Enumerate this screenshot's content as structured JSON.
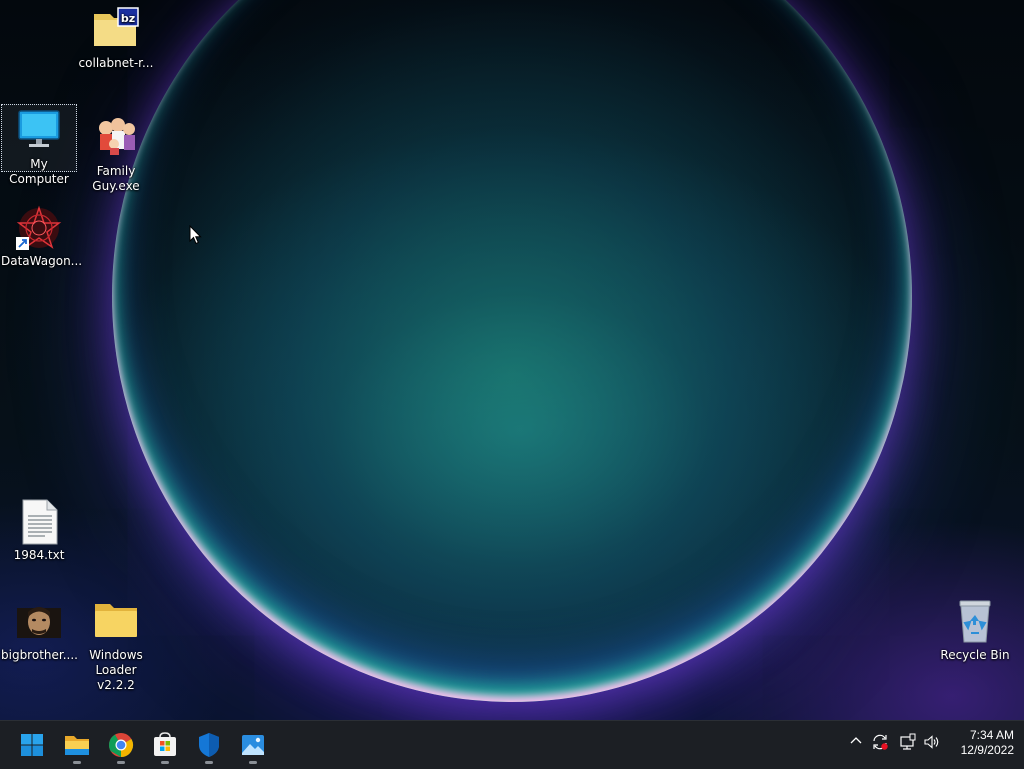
{
  "desktop": {
    "icons": [
      {
        "label": "collabnet-r...",
        "icon": "zip-folder-icon"
      },
      {
        "label": "My Computer",
        "icon": "monitor-icon",
        "selected": true
      },
      {
        "label": "Family Guy.exe",
        "icon": "family-guy-icon"
      },
      {
        "label": "DataWagon...",
        "icon": "datawagon-shortcut-icon"
      },
      {
        "label": "1984.txt",
        "icon": "text-file-icon"
      },
      {
        "label": "bigbrother....",
        "icon": "image-file-icon"
      },
      {
        "label": "Windows Loader v2.2.2",
        "icon": "folder-icon"
      },
      {
        "label": "Recycle Bin",
        "icon": "recycle-bin-icon"
      }
    ]
  },
  "taskbar": {
    "apps": [
      {
        "name": "start",
        "icon": "windows-start-icon"
      },
      {
        "name": "file-explorer",
        "icon": "file-explorer-icon"
      },
      {
        "name": "chrome",
        "icon": "chrome-icon"
      },
      {
        "name": "store",
        "icon": "store-icon"
      },
      {
        "name": "security",
        "icon": "shield-icon"
      },
      {
        "name": "photos",
        "icon": "photos-icon"
      }
    ],
    "tray": [
      "chevron-up-icon",
      "sync-error-icon",
      "network-icon",
      "volume-icon"
    ],
    "clock": {
      "time": "7:34 AM",
      "date": "12/9/2022"
    }
  },
  "colors": {
    "taskbar": "#1c1f24",
    "accent": "#0a84ff"
  }
}
